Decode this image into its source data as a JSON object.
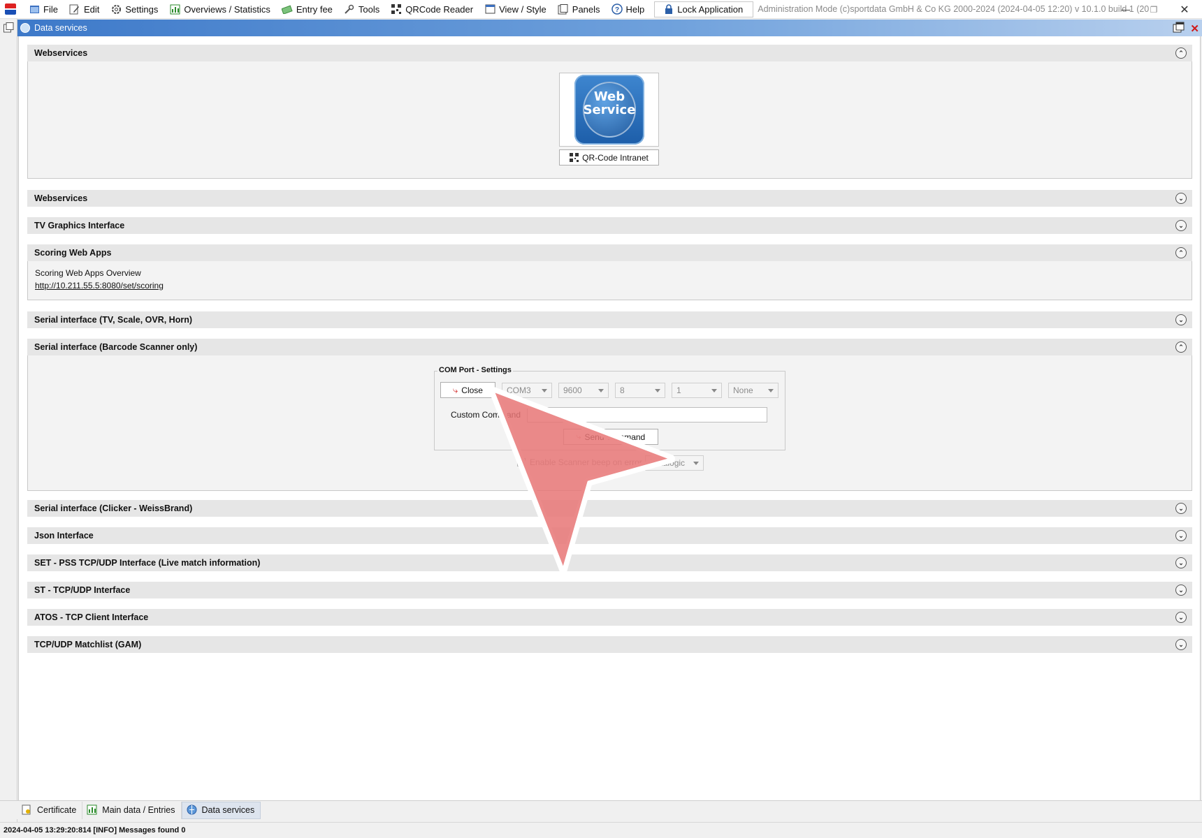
{
  "menubar": {
    "items": [
      {
        "label": "File",
        "icon": "file-icon"
      },
      {
        "label": "Edit",
        "icon": "edit-icon"
      },
      {
        "label": "Settings",
        "icon": "gear-icon"
      },
      {
        "label": "Overviews / Statistics",
        "icon": "statistics-icon"
      },
      {
        "label": "Entry fee",
        "icon": "money-icon"
      },
      {
        "label": "Tools",
        "icon": "wrench-icon"
      },
      {
        "label": "QRCode Reader",
        "icon": "qrcode-icon"
      },
      {
        "label": "View / Style",
        "icon": "view-icon"
      },
      {
        "label": "Panels",
        "icon": "panels-icon"
      },
      {
        "label": "Help",
        "icon": "help-icon"
      }
    ],
    "lock_label": "Lock Application",
    "admin_text": "Administration Mode (c)sportdata GmbH & Co KG 2000-2024 (2024-04-05 12:20)  v 10.1.0 build 1 (2024-01..."
  },
  "inner_window": {
    "title": "Data services"
  },
  "sections": [
    {
      "title": "Webservices",
      "expanded": true
    },
    {
      "title": "Webservices",
      "expanded": false
    },
    {
      "title": "TV Graphics Interface",
      "expanded": false
    },
    {
      "title": "Scoring Web Apps",
      "expanded": true
    },
    {
      "title": "Serial interface (TV, Scale, OVR, Horn)",
      "expanded": false
    },
    {
      "title": "Serial interface (Barcode Scanner only)",
      "expanded": true
    },
    {
      "title": "Serial interface (Clicker - WeissBrand)",
      "expanded": false
    },
    {
      "title": "Json Interface",
      "expanded": false
    },
    {
      "title": "SET - PSS TCP/UDP Interface (Live match information)",
      "expanded": false
    },
    {
      "title": "ST - TCP/UDP Interface",
      "expanded": false
    },
    {
      "title": "ATOS - TCP Client Interface",
      "expanded": false
    },
    {
      "title": "TCP/UDP Matchlist (GAM)",
      "expanded": false
    }
  ],
  "webservice": {
    "logo_line1": "Web",
    "logo_line2": "Service",
    "qr_button": "QR-Code Intranet"
  },
  "scoring": {
    "overview_label": "Scoring Web Apps Overview",
    "url": "http://10.211.55.5:8080/set/scoring"
  },
  "barcode": {
    "legend": "COM Port - Settings",
    "close_button": "Close",
    "port": "COM3",
    "baud": "9600",
    "databits": "8",
    "stopbits": "1",
    "parity": "None",
    "custom_command_label": "Custom Command",
    "custom_command_value": "",
    "send_button": "Send Command",
    "beep_label": "Enable Scanner beep on error",
    "beep_checked": false,
    "scanner_model": "Datalogic"
  },
  "tabs": [
    {
      "label": "Certificate",
      "active": false
    },
    {
      "label": "Main data / Entries",
      "active": false
    },
    {
      "label": "Data services",
      "active": true
    }
  ],
  "status": {
    "text": "2024-04-05 13:29:20:814 [INFO] Messages found 0"
  },
  "colors": {
    "titlebar": "#3d79c9",
    "section_header": "#e6e6e6",
    "cursor": "#e87575"
  }
}
